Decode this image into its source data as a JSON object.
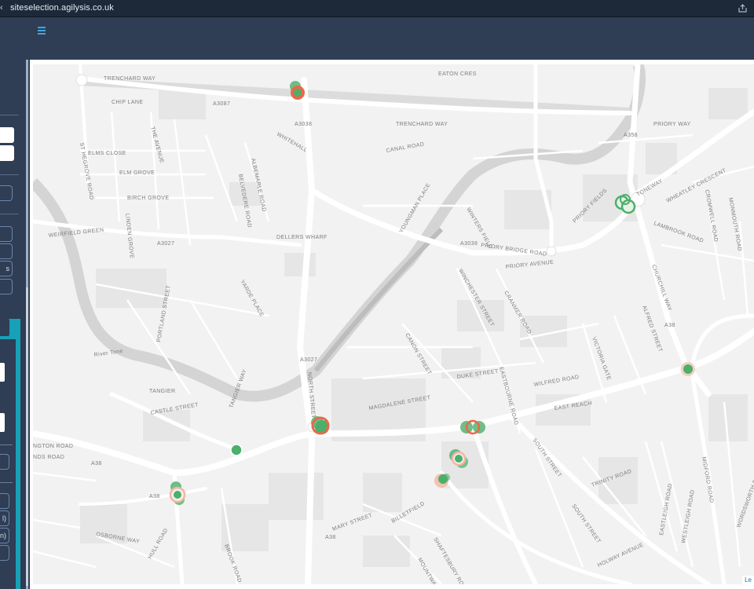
{
  "browser": {
    "url": "siteselection.agilysis.co.uk",
    "share_icon": "share-icon"
  },
  "header": {
    "menu_icon": "hamburger-menu-icon",
    "accent_color": "#3fa6dc"
  },
  "sidebar": {
    "pill_labels": [
      "",
      "",
      "",
      "s",
      "",
      "",
      "l)",
      "on)",
      ""
    ]
  },
  "map": {
    "attribution": "Le",
    "labels": [
      "TRENCHARD WAY",
      "CHIP LANE",
      "ST HEGROVE ROAD",
      "ELMS CLOSE",
      "ELM GROVE",
      "BIRCH GROVE",
      "LINDEN GROVE",
      "WEIRFIELD GREEN",
      "A3027",
      "THE AVENUE",
      "ALBEMARLE ROAD",
      "BELVEDERE ROAD",
      "A3087",
      "A3038",
      "WHITEHALL",
      "TRENCHARD WAY",
      "CANAL ROAD",
      "EATON CRES",
      "PRIORY WAY",
      "A358",
      "WHEATLEY CRESCENT",
      "TONEWAY",
      "PRIORY FIELDS",
      "PRIORY BRIDGE ROAD",
      "PRIORY AVENUE",
      "WINTERS FIELD",
      "YOUNGMAN PLACE",
      "DELLERS WHARF",
      "A3038",
      "WINCHESTER STREET",
      "CRANMER ROAD",
      "LAMBROOK ROAD",
      "CROMWELL ROAD",
      "MONMOUTH ROAD",
      "CHURCHILL WAY",
      "ALFRED STREET",
      "A38",
      "VICTORIA GATE",
      "PORTLAND STREET",
      "TANGIER WAY",
      "YARDE PLACE",
      "A3027",
      "NORTH STREET",
      "CANON STREET",
      "DUKE STREET",
      "EASTBOURNE ROAD",
      "WILFRED ROAD",
      "EAST REACH",
      "MAGDALENE STREET",
      "TANGIER",
      "CASTLE STREET",
      "River Tone",
      "A38",
      "A38",
      "SOUTH STREET",
      "TRINITY ROAD",
      "EASTLEIGH ROAD",
      "WESTLEIGH ROAD",
      "MIDFORD ROAD",
      "WORDSWORTH DRIVE",
      "MARY STREET",
      "BILLETFIELD",
      "A38",
      "HULL ROAD",
      "OSBORNE WAY",
      "SOUTH STREET",
      "HOLWAY AVENUE",
      "NGTON ROAD",
      "NDS ROAD",
      "SHAFTESBURY ROAD",
      "BROOK ROAD",
      "MOUNTWAY"
    ]
  }
}
